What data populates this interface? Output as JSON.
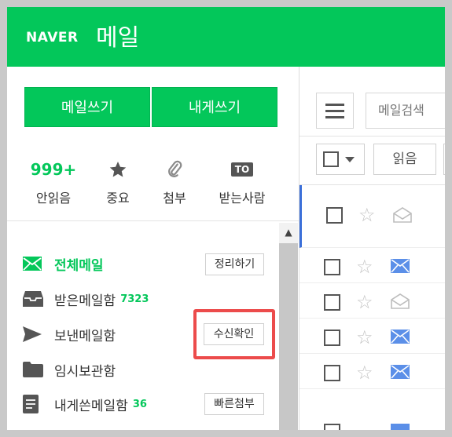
{
  "header": {
    "brand": "NAVER",
    "title": "메일"
  },
  "compose": {
    "write_label": "메일쓰기",
    "self_label": "내게쓰기"
  },
  "stats": [
    {
      "value": "999+",
      "icon": "unread-count",
      "label": "안읽음"
    },
    {
      "value": "",
      "icon": "star-icon",
      "label": "중요"
    },
    {
      "value": "",
      "icon": "paperclip-icon",
      "label": "첨부"
    },
    {
      "value": "TO",
      "icon": "to-badge",
      "label": "받는사람"
    }
  ],
  "mailboxes": [
    {
      "icon": "mail-icon",
      "name": "전체메일",
      "count": "",
      "action": "정리하기",
      "active": true
    },
    {
      "icon": "inbox-icon",
      "name": "받은메일함",
      "count": "7323",
      "action": ""
    },
    {
      "icon": "send-icon",
      "name": "보낸메일함",
      "count": "",
      "action": "수신확인"
    },
    {
      "icon": "folder-icon",
      "name": "임시보관함",
      "count": "",
      "action": ""
    },
    {
      "icon": "document-icon",
      "name": "내게쓴메일함",
      "count": "36",
      "action": "빠른첨부"
    }
  ],
  "list": {
    "search_placeholder": "메일검색",
    "read_label": "읽음",
    "rows": [
      {
        "read": true
      },
      {
        "read": false
      },
      {
        "read": true
      },
      {
        "read": false
      },
      {
        "read": false
      }
    ]
  },
  "colors": {
    "brand": "#03c75a",
    "highlight": "#ec4b4b",
    "unread_envelope": "#5b8fe8"
  }
}
